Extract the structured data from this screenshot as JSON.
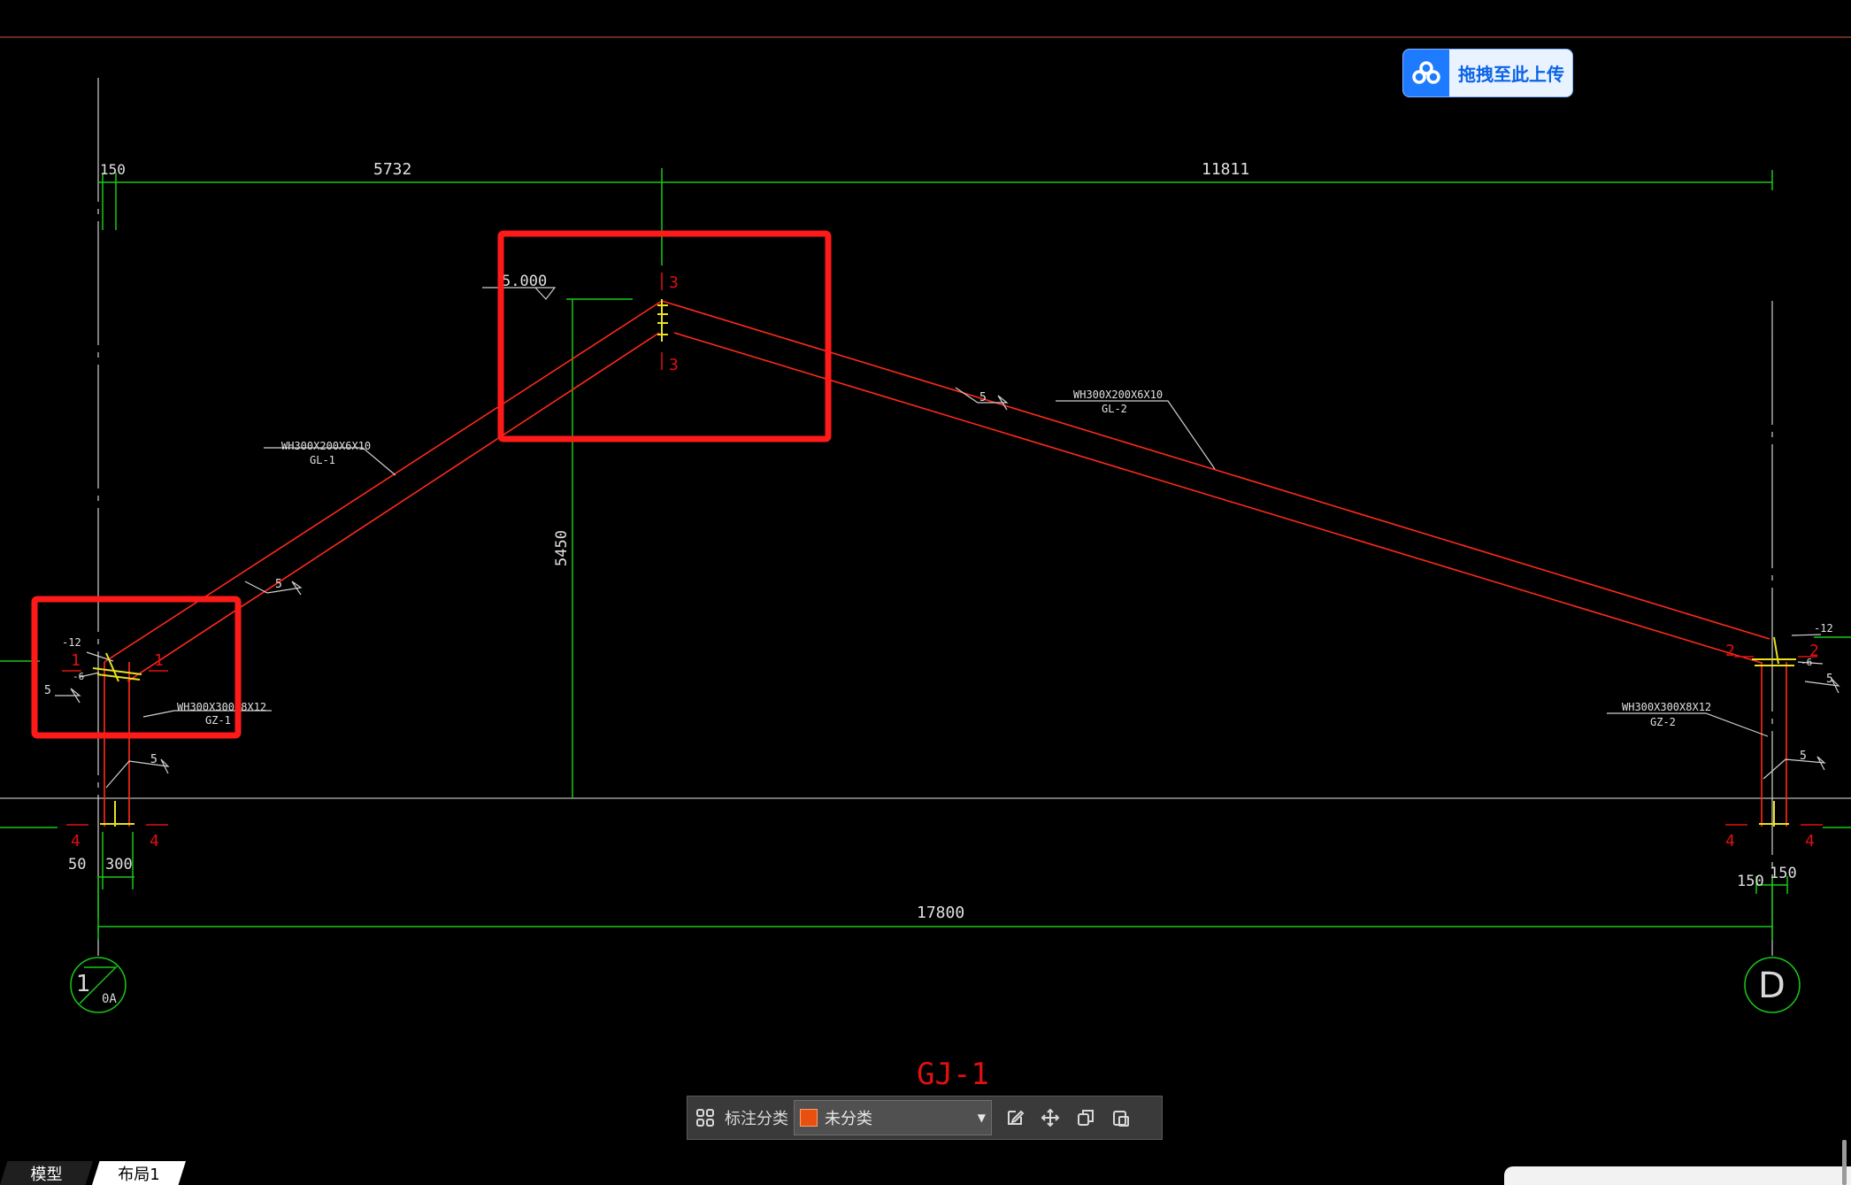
{
  "upload_button": {
    "label": "拖拽至此上传",
    "icon": "cloud-upload-icon",
    "accent": "#1e7bff"
  },
  "drawing": {
    "title": "GJ-1",
    "dims_top": [
      "150",
      "5732",
      "11811"
    ],
    "dims_bottom": [
      "50",
      "300",
      "17800",
      "150",
      "150"
    ],
    "elevation": "5.000",
    "height_dim": "5450",
    "members": [
      {
        "section": "WH300X200X6X10",
        "tag": "GL-1"
      },
      {
        "section": "WH300X200X6X10",
        "tag": "GL-2"
      },
      {
        "section": "WH300X300X8X12",
        "tag": "GZ-1"
      },
      {
        "section": "WH300X300X8X12",
        "tag": "GZ-2"
      }
    ],
    "weld_size": "5",
    "plates": [
      "-12",
      "-12",
      "-6",
      "-6"
    ],
    "section_marks": [
      "1",
      "1",
      "2",
      "2",
      "3",
      "3",
      "4",
      "4",
      "4",
      "4"
    ],
    "axes": [
      {
        "label": "1",
        "sub": "0A"
      },
      {
        "label": "D",
        "sub": ""
      }
    ],
    "colors": {
      "background": "#000000",
      "member": "#ff2a1a",
      "dimension": "#19c819",
      "text": "#e0e0e0",
      "highlight": "#ff1a1a",
      "section_mark": "#e01010",
      "connection": "#e8e020"
    }
  },
  "toolbar": {
    "grid_icon": "grid-icon",
    "category_label": "标注分类",
    "category_value": "未分类",
    "category_color": "#e8500f",
    "tools": [
      "edit-icon",
      "move-icon",
      "copy-icon",
      "paste-icon"
    ]
  },
  "tabs": [
    "模型",
    "布局1"
  ]
}
